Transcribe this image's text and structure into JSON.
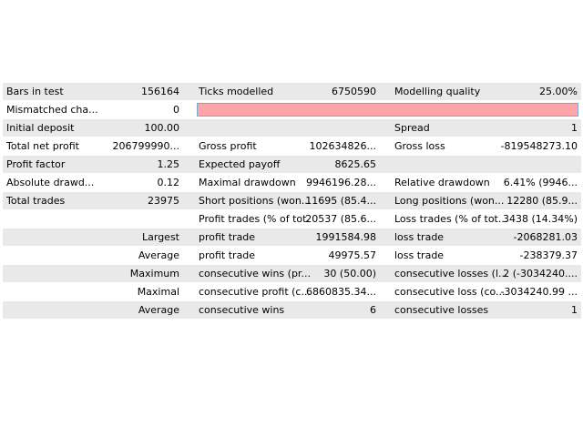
{
  "report": {
    "rows": [
      {
        "c1": "Bars in test",
        "c2": "156164",
        "c3": "Ticks modelled",
        "c4": "6750590",
        "c5": "Modelling quality",
        "c6": "25.00%"
      },
      {
        "c1": "Mismatched cha...",
        "c2": "0",
        "quality_bar_fraction": 0.25
      },
      {
        "c1": "Initial deposit",
        "c2": "100.00",
        "c3": "",
        "c4": "",
        "c5": "Spread",
        "c6": "1"
      },
      {
        "c1": "Total net profit",
        "c2": "206799990...",
        "c3": "Gross profit",
        "c4": "102634826...",
        "c5": "Gross loss",
        "c6": "-819548273.10"
      },
      {
        "c1": "Profit factor",
        "c2": "1.25",
        "c3": "Expected payoff",
        "c4": "8625.65",
        "c5": "",
        "c6": ""
      },
      {
        "c1": "Absolute drawd...",
        "c2": "0.12",
        "c3": "Maximal drawdown",
        "c4": "9946196.28...",
        "c5": "Relative drawdown",
        "c6": "6.41% (9946..."
      },
      {
        "c1": "Total trades",
        "c2": "23975",
        "c3": "Short positions (won...",
        "c4": "11695 (85.4...",
        "c5": "Long positions (won...",
        "c6": "12280 (85.9..."
      },
      {
        "c1": "",
        "c2": "",
        "c3": "Profit trades (% of tot...",
        "c4": "20537 (85.6...",
        "c5": "Loss trades (% of tot...",
        "c6": "3438 (14.34%)"
      },
      {
        "c1": "",
        "c2": "Largest",
        "c3": "profit trade",
        "c4": "1991584.98",
        "c5": "loss trade",
        "c6": "-2068281.03"
      },
      {
        "c1": "",
        "c2": "Average",
        "c3": "profit trade",
        "c4": "49975.57",
        "c5": "loss trade",
        "c6": "-238379.37"
      },
      {
        "c1": "",
        "c2": "Maximum",
        "c3": "consecutive wins (pr...",
        "c4": "30 (50.00)",
        "c5": "consecutive losses (l...",
        "c6": "2 (-3034240...."
      },
      {
        "c1": "",
        "c2": "Maximal",
        "c3": "consecutive profit (c...",
        "c4": "6860835.34...",
        "c5": "consecutive loss (co...",
        "c6": "-3034240.99 ..."
      },
      {
        "c1": "",
        "c2": "Average",
        "c3": "consecutive wins",
        "c4": "6",
        "c5": "consecutive losses",
        "c6": "1"
      }
    ]
  },
  "colors": {
    "row_shade": "#e9e9e9",
    "quality_bar_fill": "#ffa4a8",
    "quality_bar_border": "#7aa9d6"
  }
}
